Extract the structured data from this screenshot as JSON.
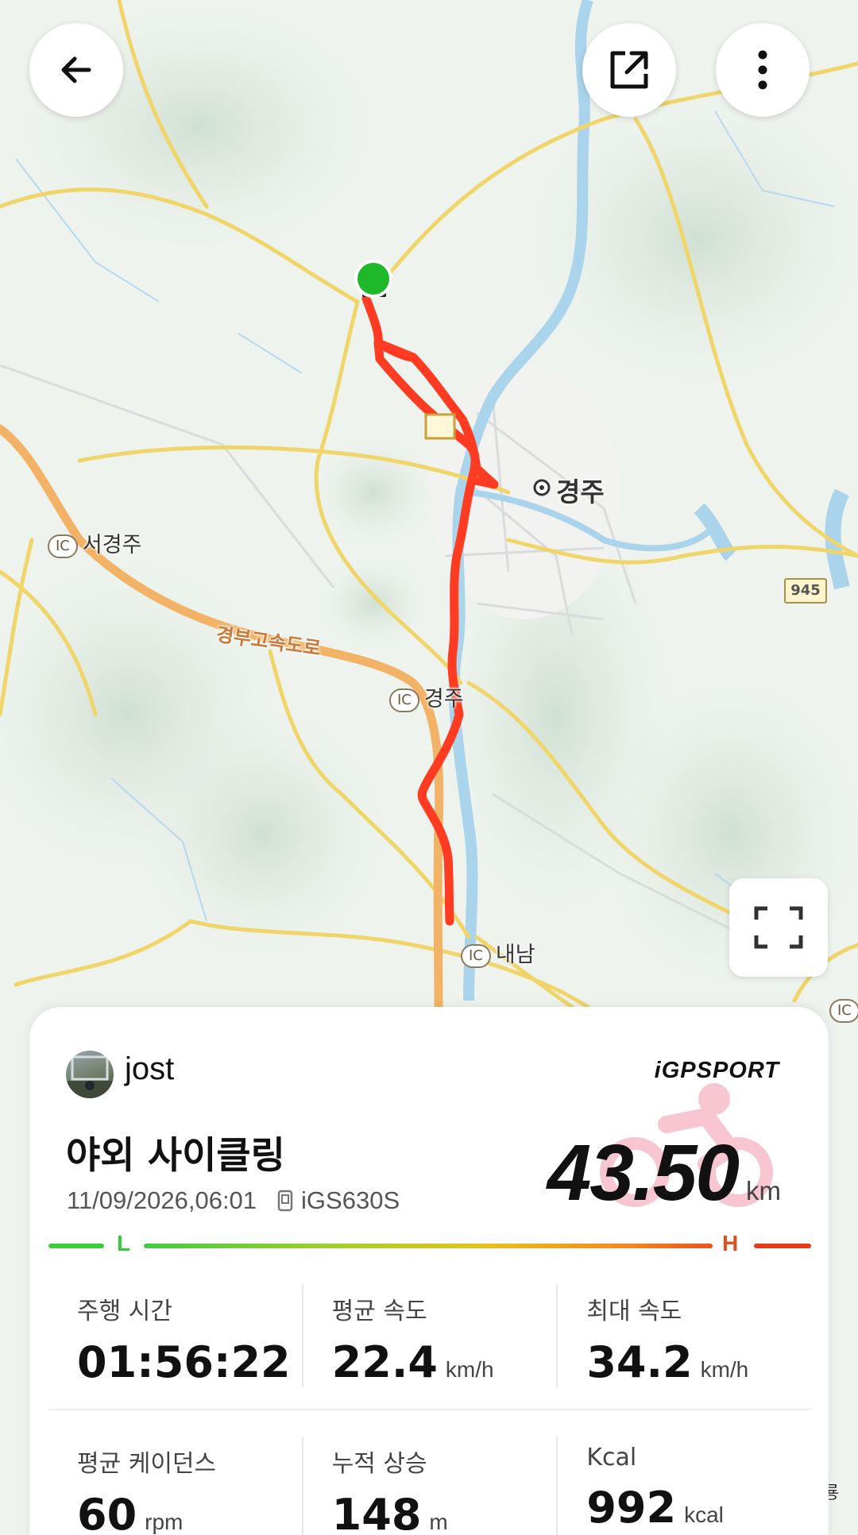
{
  "map": {
    "labels": {
      "city": "경주",
      "west_ic": "서경주",
      "expressway": "경부고속도로",
      "gyeongju_ic": "경주",
      "naenam_ic": "내남",
      "ic_badge": "IC",
      "route_number": "945",
      "edge_text": "룡"
    },
    "route_color": "#ff3b22",
    "start_marker_color": "#1fb82b"
  },
  "toolbar": {
    "back_icon": "arrow-left-icon",
    "share_icon": "share-external-icon",
    "more_icon": "more-vertical-icon",
    "fullscreen_icon": "fullscreen-icon"
  },
  "card": {
    "username": "jost",
    "brand": "iGPSPORT",
    "title": "야외 사이클링",
    "date": "11/09/2026,06:01",
    "device": "iGS630S",
    "distance": "43.50",
    "distance_unit": "km",
    "intensity": {
      "low_label": "L",
      "high_label": "H"
    },
    "stats_row1": [
      {
        "label": "주행 시간",
        "value": "01:56:22",
        "unit": ""
      },
      {
        "label": "평균 속도",
        "value": "22.4",
        "unit": "km/h"
      },
      {
        "label": "최대 속도",
        "value": "34.2",
        "unit": "km/h"
      }
    ],
    "stats_row2": [
      {
        "label": "평균 케이던스",
        "value": "60",
        "unit": "rpm"
      },
      {
        "label": "누적 상승",
        "value": "148",
        "unit": "m"
      },
      {
        "label": "Kcal",
        "value": "992",
        "unit": "kcal"
      }
    ]
  }
}
